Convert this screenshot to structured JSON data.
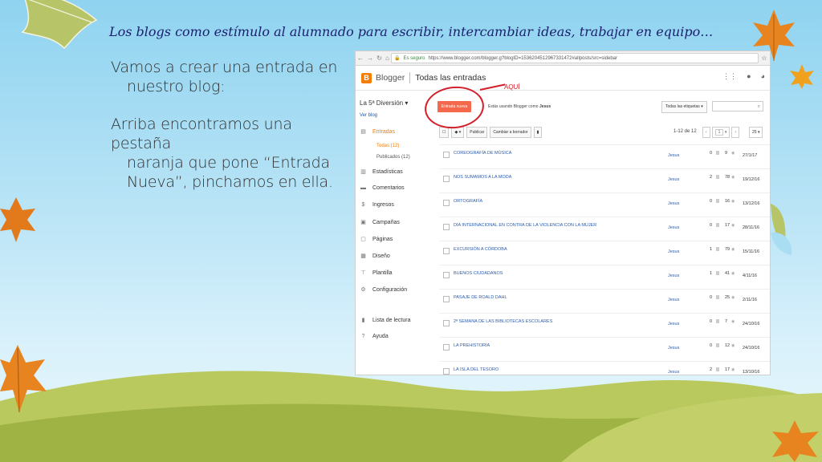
{
  "slide": {
    "title": "Los blogs como estímulo al alumnado para escribir, intercambiar ideas, trabajar en equipo…",
    "paragraph1_line1": "Vamos a crear una entrada en",
    "paragraph1_line2": "nuestro blog:",
    "paragraph2_line1": "Arriba encontramos una pestaña",
    "paragraph2_line2": "naranja que pone “Entrada",
    "paragraph2_line3": "Nueva”, pinchamos en ella.",
    "annotation": "AQUÍ",
    "colors": {
      "title": "#1b1f6e",
      "annotation": "#d3202b",
      "leaf_orange": "#e8841f",
      "leaf_green": "#b6c764",
      "hill": "#a7b84a"
    }
  },
  "browser": {
    "security": "Es seguro",
    "url": "https://www.blogger.com/blogger.g?blogID=1536204512967331472#allposts/src=sidebar",
    "nav_icons": [
      "back-icon",
      "forward-icon",
      "reload-icon",
      "home-icon"
    ]
  },
  "blogger": {
    "brand": "Blogger",
    "page": "Todas las entradas",
    "blog_name": "La 5ª Diversión",
    "view_blog": "Ver blog",
    "new_post": "Entrada nueva",
    "using_as_prefix": "Estás usando Blogger como",
    "using_as_user": "Jesus",
    "label_filter": "Todas las etiquetas",
    "sidebar": [
      {
        "label": "Entradas",
        "icon": "posts-icon"
      },
      {
        "label": "Estadísticas",
        "icon": "stats-icon"
      },
      {
        "label": "Comentarios",
        "icon": "comments-icon"
      },
      {
        "label": "Ingresos",
        "icon": "dollar-icon"
      },
      {
        "label": "Campañas",
        "icon": "campaign-icon"
      },
      {
        "label": "Páginas",
        "icon": "pages-icon"
      },
      {
        "label": "Diseño",
        "icon": "layout-icon"
      },
      {
        "label": "Plantilla",
        "icon": "template-icon"
      },
      {
        "label": "Configuración",
        "icon": "gear-icon"
      },
      {
        "label": "Lista de lectura",
        "icon": "bookmark-icon"
      },
      {
        "label": "Ayuda",
        "icon": "help-icon"
      }
    ],
    "sub_all": "Todas (12)",
    "sub_published": "Publicados (12)",
    "toolbar": {
      "publish": "Publicar",
      "draft": "Cambiar a borrador"
    },
    "count": "1-12 de 12",
    "page_num": "1",
    "per_page": "25",
    "posts": [
      {
        "title": "COREOGRAFÍA DE MÚSICA",
        "author": "Jesus",
        "comments": "0",
        "views": "9",
        "date": "27/1/17"
      },
      {
        "title": "NOS SUMAMOS A LA MODA",
        "author": "Jesus",
        "comments": "2",
        "views": "78",
        "date": "19/12/16"
      },
      {
        "title": "ORTOGRAFÍA",
        "author": "Jesus",
        "comments": "0",
        "views": "16",
        "date": "13/12/16"
      },
      {
        "title": "DÍA INTERNACIONAL EN CONTRA DE LA VIOLENCIA CON LA MUJER",
        "author": "Jesus",
        "comments": "0",
        "views": "17",
        "date": "28/11/16"
      },
      {
        "title": "EXCURSIÓN A CÓRDOBA",
        "author": "Jesus",
        "comments": "1",
        "views": "79",
        "date": "15/11/16"
      },
      {
        "title": "BUENOS CIUDADANOS",
        "author": "Jesus",
        "comments": "1",
        "views": "41",
        "date": "4/11/16"
      },
      {
        "title": "PASAJE DE ROALD DAHL",
        "author": "Jesus",
        "comments": "0",
        "views": "25",
        "date": "2/11/16"
      },
      {
        "title": "2ª SEMANA DE LAS BIBLIOTECAS ESCOLARES",
        "author": "Jesus",
        "comments": "0",
        "views": "7",
        "date": "24/10/16"
      },
      {
        "title": "LA PREHISTORIA",
        "author": "Jesus",
        "comments": "0",
        "views": "12",
        "date": "24/10/16"
      },
      {
        "title": "LA ISLA DEL TESORO",
        "author": "Jesus",
        "comments": "2",
        "views": "17",
        "date": "13/10/16"
      }
    ]
  }
}
